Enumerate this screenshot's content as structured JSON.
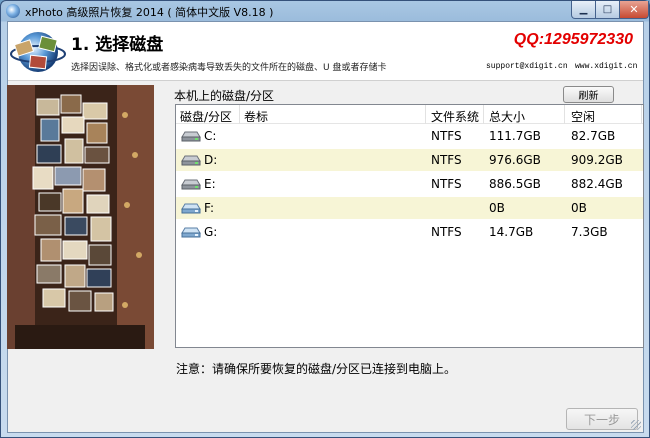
{
  "window": {
    "title": "xPhoto 高级照片恢复 2014 ( 简体中文版 V8.18 )",
    "controls": {
      "minimize": "▁",
      "maximize": "□",
      "close": "✕"
    }
  },
  "header": {
    "step_title": "1. 选择磁盘",
    "description": "选择因误除、格式化或者感染病毒导致丢失的文件所在的磁盘、U 盘或者存储卡",
    "qq": "QQ:1295972330",
    "support_email": "support@xdigit.cn",
    "website": "www.xdigit.cn"
  },
  "disks": {
    "label": "本机上的磁盘/分区",
    "refresh_label": "刷新",
    "columns": [
      "磁盘/分区",
      "卷标",
      "文件系统",
      "总大小",
      "空闲"
    ],
    "rows": [
      {
        "drive": "C:",
        "volume": "",
        "fs": "NTFS",
        "total": "111.7GB",
        "free": "82.7GB",
        "icon": "hard-drive-icon"
      },
      {
        "drive": "D:",
        "volume": "",
        "fs": "NTFS",
        "total": "976.6GB",
        "free": "909.2GB",
        "icon": "hard-drive-icon"
      },
      {
        "drive": "E:",
        "volume": "",
        "fs": "NTFS",
        "total": "886.5GB",
        "free": "882.4GB",
        "icon": "hard-drive-icon"
      },
      {
        "drive": "F:",
        "volume": "",
        "fs": "",
        "total": "0B",
        "free": "0B",
        "icon": "removable-drive-icon"
      },
      {
        "drive": "G:",
        "volume": "",
        "fs": "NTFS",
        "total": "14.7GB",
        "free": "7.3GB",
        "icon": "removable-drive-icon"
      }
    ]
  },
  "note": "注意：请确保所要恢复的磁盘/分区已连接到电脑上。",
  "next_label": "下一步",
  "colors": {
    "qq": "#e30000",
    "row_alt": "#f7f5d6",
    "title_bar": "#9bbcdc"
  }
}
